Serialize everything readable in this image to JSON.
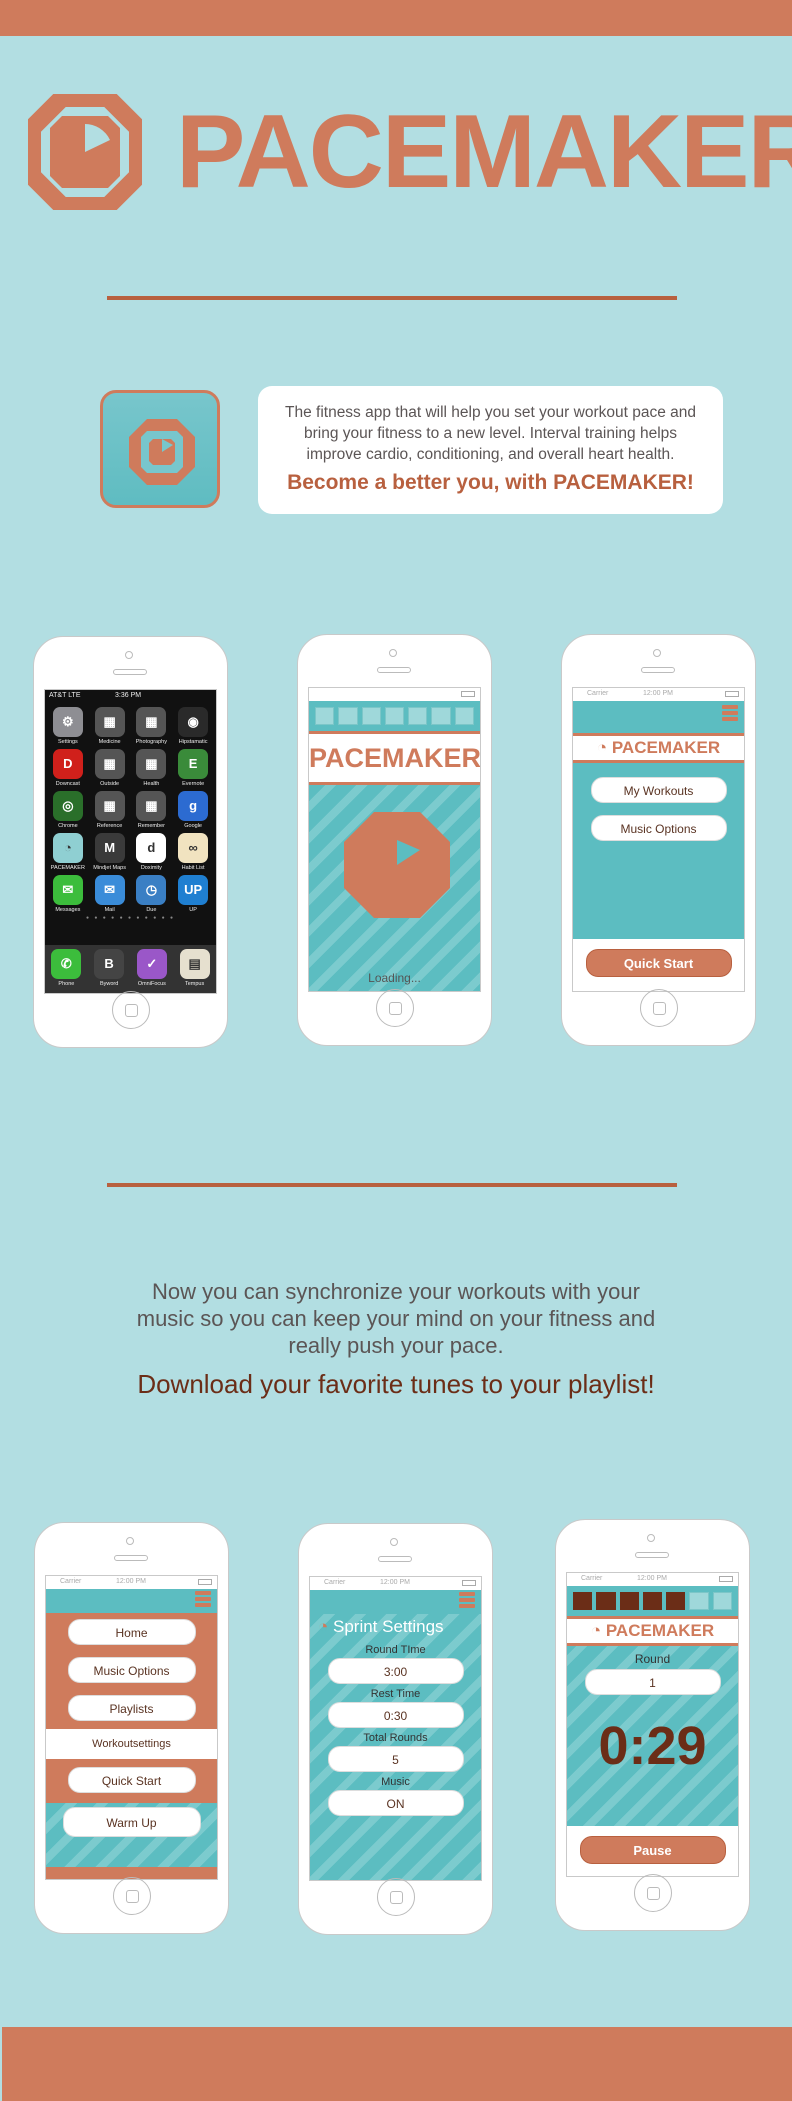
{
  "brand": {
    "name": "PACEMAKER"
  },
  "intro": {
    "body": "The fitness app that will help you set your workout pace and bring your fitness to a new level. Interval training helps improve cardio, conditioning, and overall heart health.",
    "tagline": "Become a better you, with PACEMAKER!"
  },
  "phone1": {
    "status_carrier": "AT&T  LTE",
    "status_time": "3:36 PM",
    "apps": [
      {
        "label": "Settings",
        "color": "#8e8e93",
        "glyph": "⚙"
      },
      {
        "label": "Medicine",
        "color": "#555555",
        "glyph": "▦"
      },
      {
        "label": "Photography",
        "color": "#555555",
        "glyph": "▦"
      },
      {
        "label": "Hipstamatic",
        "color": "#2a2a2a",
        "glyph": "◉"
      },
      {
        "label": "Downcast",
        "color": "#d0201b",
        "glyph": "D"
      },
      {
        "label": "Outside",
        "color": "#555555",
        "glyph": "▦"
      },
      {
        "label": "Health",
        "color": "#555555",
        "glyph": "▦"
      },
      {
        "label": "Evernote",
        "color": "#3a8b3a",
        "glyph": "E"
      },
      {
        "label": "Chrome",
        "color": "#2a6f2a",
        "glyph": "◎"
      },
      {
        "label": "Reference",
        "color": "#555555",
        "glyph": "▦"
      },
      {
        "label": "Remember",
        "color": "#555555",
        "glyph": "▦"
      },
      {
        "label": "Google",
        "color": "#2c6bd1",
        "glyph": "g"
      },
      {
        "label": "PACEMAKER",
        "color": "#8fcfd2",
        "glyph": "◔"
      },
      {
        "label": "Mindjet Maps",
        "color": "#3a3a3a",
        "glyph": "M"
      },
      {
        "label": "Doximity",
        "color": "#ffffff",
        "glyph": "d"
      },
      {
        "label": "Habit List",
        "color": "#f1e3c0",
        "glyph": "∞"
      },
      {
        "label": "Messages",
        "color": "#3cbd3c",
        "glyph": "✉"
      },
      {
        "label": "Mail",
        "color": "#3a8cd9",
        "glyph": "✉"
      },
      {
        "label": "Due",
        "color": "#3a7fc4",
        "glyph": "◷"
      },
      {
        "label": "UP",
        "color": "#1f7fd1",
        "glyph": "UP"
      }
    ],
    "dock": [
      {
        "label": "Phone",
        "color": "#3cbd3c",
        "glyph": "✆"
      },
      {
        "label": "Byword",
        "color": "#444444",
        "glyph": "B"
      },
      {
        "label": "OmniFocus",
        "color": "#9a57c8",
        "glyph": "✓"
      },
      {
        "label": "Tempus",
        "color": "#e6e0cf",
        "glyph": "▤"
      }
    ]
  },
  "phone2": {
    "loading": "Loading..."
  },
  "phone3": {
    "status_carrier": "Carrier",
    "status_time": "12:00 PM",
    "buttons": [
      "My Workouts",
      "Music Options"
    ],
    "quick_start": "Quick Start"
  },
  "sync": {
    "body": "Now you can synchronize your workouts with your music so you can keep your mind on your fitness and really push your pace.",
    "tagline": "Download your favorite tunes to your playlist!"
  },
  "phone4": {
    "status_carrier": "Carrier",
    "status_time": "12:00 PM",
    "menu": [
      "Home",
      "Music Options",
      "Playlists"
    ],
    "section_label": "Workoutsettings",
    "quick_start": "Quick Start",
    "warm_up": "Warm Up"
  },
  "phone5": {
    "status_carrier": "Carrier",
    "status_time": "12:00 PM",
    "title": "Sprint Settings",
    "fields": [
      {
        "label": "Round TIme",
        "value": "3:00"
      },
      {
        "label": "Rest Time",
        "value": "0:30"
      },
      {
        "label": "Total Rounds",
        "value": "5"
      },
      {
        "label": "Music",
        "value": "ON"
      }
    ]
  },
  "phone6": {
    "status_carrier": "Carrier",
    "status_time": "12:00 PM",
    "round_label": "Round",
    "round_value": "1",
    "timer": "0:29",
    "pause": "Pause"
  },
  "colors": {
    "background": "#b2dee2",
    "accent": "#cf7b5c",
    "dark_accent": "#6b2d17",
    "screen": "#5cbdc1"
  }
}
